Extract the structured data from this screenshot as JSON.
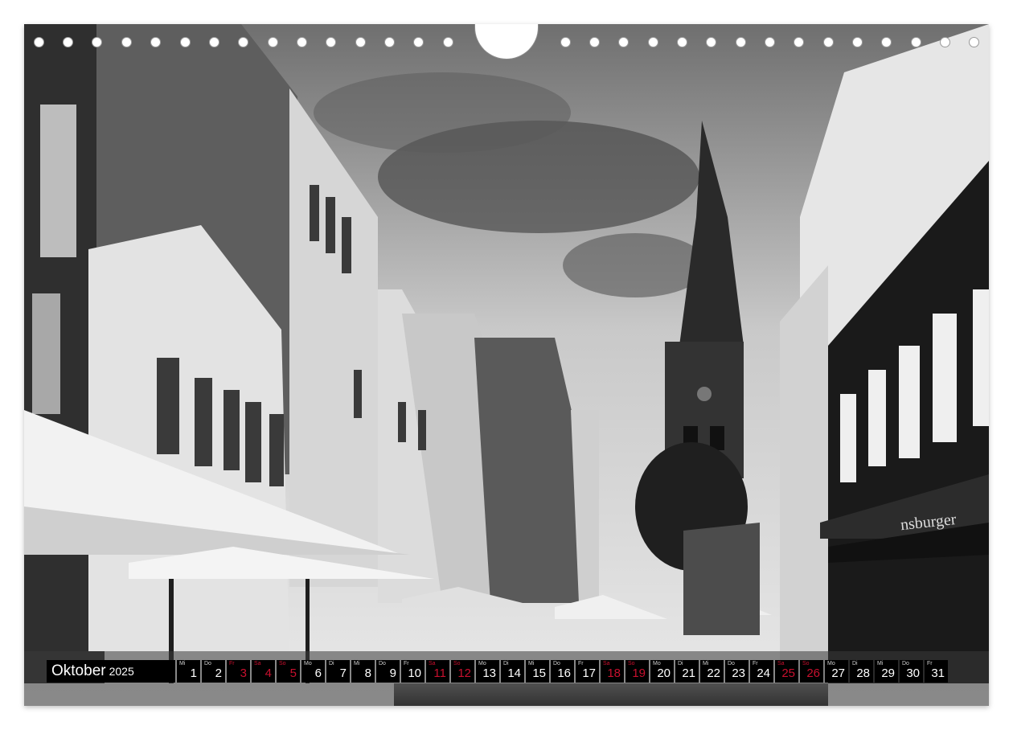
{
  "calendar": {
    "month": "Oktober",
    "year": "2025",
    "weekend_color": "#c8102e",
    "days": [
      {
        "num": "1",
        "wd": "Mi",
        "red": false
      },
      {
        "num": "2",
        "wd": "Do",
        "red": false
      },
      {
        "num": "3",
        "wd": "Fr",
        "red": true
      },
      {
        "num": "4",
        "wd": "Sa",
        "red": true
      },
      {
        "num": "5",
        "wd": "So",
        "red": true
      },
      {
        "num": "6",
        "wd": "Mo",
        "red": false
      },
      {
        "num": "7",
        "wd": "Di",
        "red": false
      },
      {
        "num": "8",
        "wd": "Mi",
        "red": false
      },
      {
        "num": "9",
        "wd": "Do",
        "red": false
      },
      {
        "num": "10",
        "wd": "Fr",
        "red": false
      },
      {
        "num": "11",
        "wd": "Sa",
        "red": true
      },
      {
        "num": "12",
        "wd": "So",
        "red": true
      },
      {
        "num": "13",
        "wd": "Mo",
        "red": false
      },
      {
        "num": "14",
        "wd": "Di",
        "red": false
      },
      {
        "num": "15",
        "wd": "Mi",
        "red": false
      },
      {
        "num": "16",
        "wd": "Do",
        "red": false
      },
      {
        "num": "17",
        "wd": "Fr",
        "red": false
      },
      {
        "num": "18",
        "wd": "Sa",
        "red": true
      },
      {
        "num": "19",
        "wd": "So",
        "red": true
      },
      {
        "num": "20",
        "wd": "Mo",
        "red": false
      },
      {
        "num": "21",
        "wd": "Di",
        "red": false
      },
      {
        "num": "22",
        "wd": "Mi",
        "red": false
      },
      {
        "num": "23",
        "wd": "Do",
        "red": false
      },
      {
        "num": "24",
        "wd": "Fr",
        "red": false
      },
      {
        "num": "25",
        "wd": "Sa",
        "red": true
      },
      {
        "num": "26",
        "wd": "So",
        "red": true
      },
      {
        "num": "27",
        "wd": "Mo",
        "red": false
      },
      {
        "num": "28",
        "wd": "Di",
        "red": false
      },
      {
        "num": "29",
        "wd": "Mi",
        "red": false
      },
      {
        "num": "30",
        "wd": "Do",
        "red": false
      },
      {
        "num": "31",
        "wd": "Fr",
        "red": false
      }
    ]
  },
  "photo": {
    "subject": "black-and-white street scene with church spire",
    "awning_text": "nsburger"
  }
}
